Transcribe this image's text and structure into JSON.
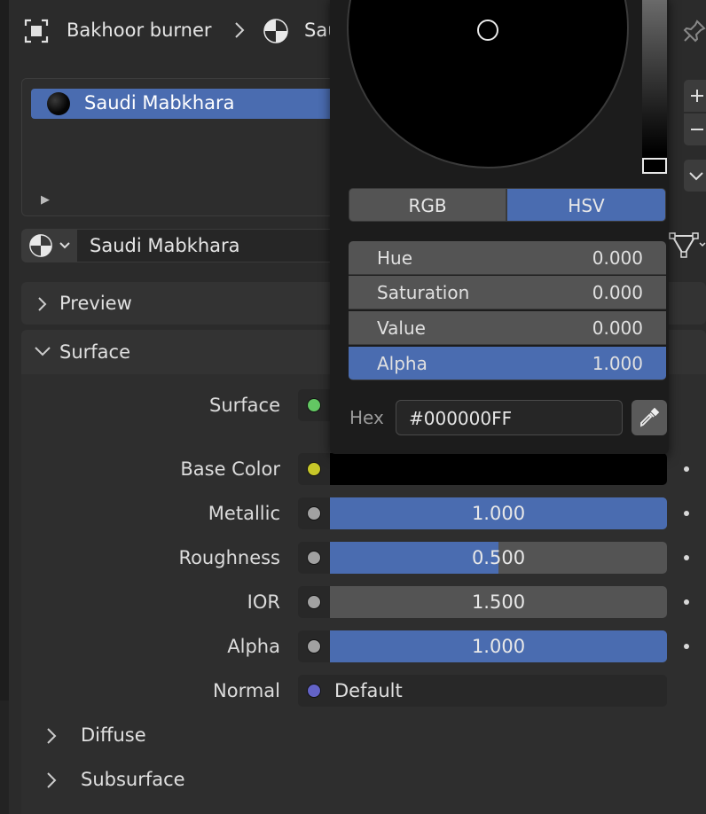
{
  "header": {
    "object_name": "Bakhoor burner",
    "material_truncated": "Sau"
  },
  "slots": {
    "items": [
      {
        "label": "Saudi Mabkhara"
      }
    ]
  },
  "material_selector": {
    "name": "Saudi Mabkhara"
  },
  "panels": {
    "preview": "Preview",
    "surface": "Surface"
  },
  "properties": [
    {
      "label": "Surface",
      "socket_color": "#63c763"
    },
    {
      "label": "Base Color",
      "socket_color": "#c7c729"
    },
    {
      "label": "Metallic",
      "value": "1.000",
      "fraction": 1.0,
      "socket_color": "#a1a1a1"
    },
    {
      "label": "Roughness",
      "value": "0.500",
      "fraction": 0.5,
      "socket_color": "#a1a1a1"
    },
    {
      "label": "IOR",
      "value": "1.500",
      "fraction": 0.0,
      "socket_color": "#a1a1a1"
    },
    {
      "label": "Alpha",
      "value": "1.000",
      "fraction": 1.0,
      "socket_color": "#a1a1a1"
    },
    {
      "label": "Normal",
      "value": "Default",
      "socket_color": "#6363c7"
    }
  ],
  "subpanels": [
    "Diffuse",
    "Subsurface"
  ],
  "color_picker": {
    "modes": [
      "RGB",
      "HSV"
    ],
    "active_mode": "HSV",
    "fields": [
      {
        "name": "Hue",
        "value": "0.000"
      },
      {
        "name": "Saturation",
        "value": "0.000"
      },
      {
        "name": "Value",
        "value": "0.000"
      },
      {
        "name": "Alpha",
        "value": "1.000"
      }
    ],
    "hex_label": "Hex",
    "hex_value": "#000000FF"
  },
  "colors": {
    "accent": "#4a6cb0",
    "base_color": "#000000"
  }
}
